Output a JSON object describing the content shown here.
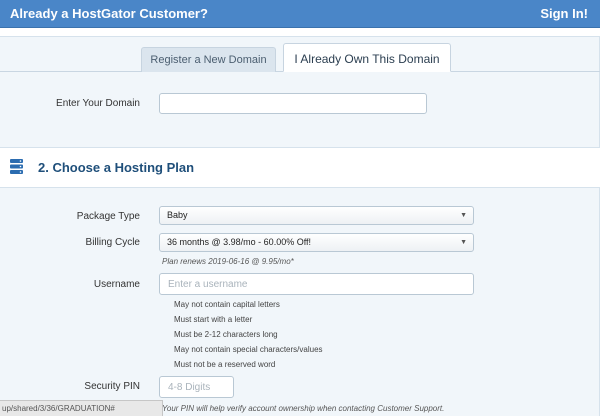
{
  "header": {
    "title": "Already a HostGator Customer?",
    "signin_label": "Sign In!"
  },
  "domain": {
    "tabs": [
      {
        "label": "Register a New Domain",
        "active": false
      },
      {
        "label": "I Already Own This Domain",
        "active": true
      }
    ],
    "field_label": "Enter Your Domain",
    "value": ""
  },
  "hosting": {
    "section_icon": "server-stack-icon",
    "section_title": "2. Choose a Hosting Plan",
    "package_label": "Package Type",
    "package_value": "Baby",
    "billing_label": "Billing Cycle",
    "billing_value": "36 months @ 3.98/mo - 60.00% Off!",
    "renew_note": "Plan renews 2019-06-16 @ 9.95/mo*",
    "username_label": "Username",
    "username_placeholder": "Enter a username",
    "username_rules": [
      "May not contain capital letters",
      "Must start with a letter",
      "Must be 2-12 characters long",
      "May not contain special characters/values",
      "Must not be a reserved word"
    ],
    "pin_label": "Security PIN",
    "pin_placeholder": "4-8 Digits",
    "pin_note": "Your PIN will help verify account ownership when contacting Customer Support."
  },
  "statusbar": {
    "url": "up/shared/3/36/GRADUATION#"
  },
  "colors": {
    "header_bg": "#4a86c8",
    "section_title": "#1f4f7a",
    "panel_bg": "#f1f6fa"
  }
}
